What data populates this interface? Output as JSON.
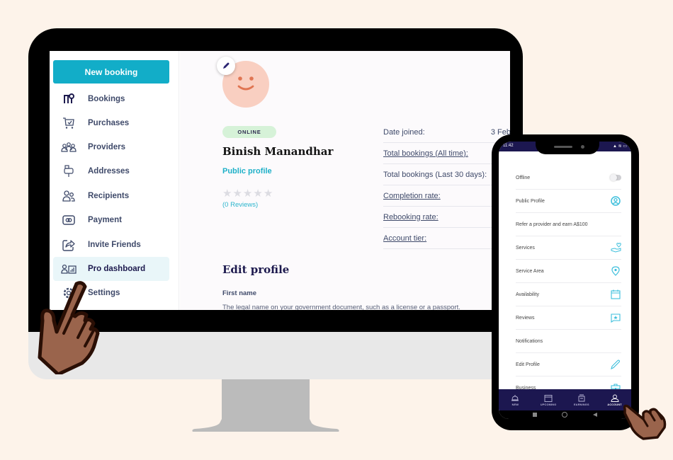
{
  "desktop": {
    "sidebar": {
      "new_booking_label": "New booking",
      "items": [
        {
          "label": "Bookings",
          "icon": "bookings-icon"
        },
        {
          "label": "Purchases",
          "icon": "cart-icon"
        },
        {
          "label": "Providers",
          "icon": "providers-icon"
        },
        {
          "label": "Addresses",
          "icon": "mailbox-icon"
        },
        {
          "label": "Recipients",
          "icon": "users-icon"
        },
        {
          "label": "Payment",
          "icon": "payment-icon"
        },
        {
          "label": "Invite Friends",
          "icon": "share-icon"
        },
        {
          "label": "Pro dashboard",
          "icon": "pro-dashboard-icon",
          "active": true
        },
        {
          "label": "Settings",
          "icon": "gear-icon"
        }
      ]
    },
    "profile": {
      "status": "ONLINE",
      "name": "Binish Manandhar",
      "public_profile_label": "Public profile",
      "rating": 0,
      "max_rating": 5,
      "reviews_label": "(0 Reviews)"
    },
    "stats": [
      {
        "label": "Date joined:",
        "value": "3 Feb",
        "underlined": false
      },
      {
        "label": "Total bookings (All time):",
        "value": "",
        "underlined": true
      },
      {
        "label": "Total bookings (Last 30 days):",
        "value": "",
        "underlined": false
      },
      {
        "label": "Completion rate:",
        "value": "",
        "underlined": true
      },
      {
        "label": "Rebooking rate:",
        "value": "",
        "underlined": true
      },
      {
        "label": "Account tier:",
        "value": "",
        "underlined": true
      }
    ],
    "edit_profile": {
      "title": "Edit profile",
      "first_name_label": "First name",
      "first_name_help": "The legal name on your government document, such as a license or a passport."
    }
  },
  "phone": {
    "status_bar": {
      "time": "11:42",
      "icons": "▲ ≋ ▭"
    },
    "menu": [
      {
        "label": "Offline",
        "icon": "toggle"
      },
      {
        "label": "Public Profile",
        "icon": "profile-circle-icon"
      },
      {
        "label": "Refer a provider and earn A$100",
        "icon": ""
      },
      {
        "label": "Services",
        "icon": "hand-heart-icon"
      },
      {
        "label": "Service Area",
        "icon": "location-pin-icon"
      },
      {
        "label": "Availability",
        "icon": "calendar-icon"
      },
      {
        "label": "Reviews",
        "icon": "star-message-icon"
      },
      {
        "label": "Notifications",
        "icon": ""
      },
      {
        "label": "Edit Profile",
        "icon": "pencil-icon"
      },
      {
        "label": "Business",
        "icon": "briefcase-icon"
      }
    ],
    "tabs": [
      {
        "label": "NEW",
        "icon": "bell-service-icon"
      },
      {
        "label": "UPCOMING",
        "icon": "calendar-icon"
      },
      {
        "label": "EARNINGS",
        "icon": "register-icon"
      },
      {
        "label": "ACCOUNT",
        "icon": "user-icon",
        "active": true
      }
    ]
  },
  "colors": {
    "background": "#fdf3ea",
    "accent": "#12adc8",
    "navy": "#1c1750",
    "online_badge": "#d6f2d8",
    "hand": "#9a644c"
  }
}
